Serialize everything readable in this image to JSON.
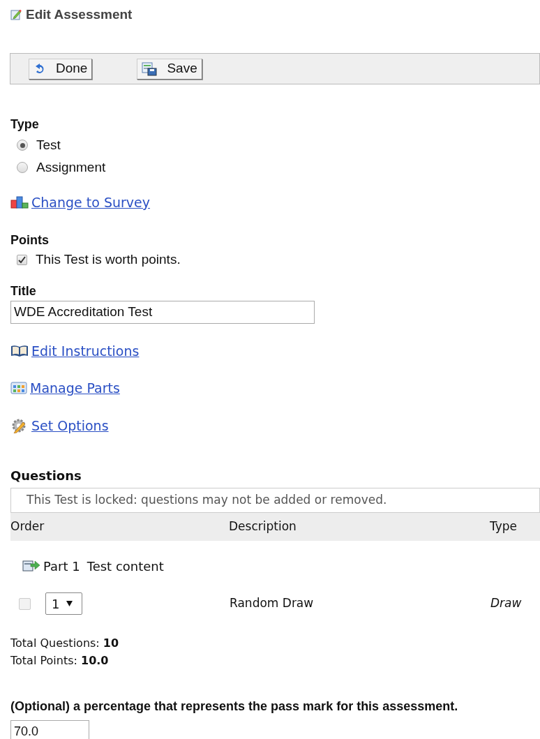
{
  "heading": "Edit Assessment",
  "toolbar": [
    {
      "kind": "done",
      "label": "Done"
    },
    {
      "kind": "save",
      "label": "Save"
    }
  ],
  "type": {
    "label": "Type",
    "options": [
      {
        "label": "Test",
        "selected": true
      },
      {
        "label": "Assignment",
        "selected": false
      }
    ]
  },
  "change_link": "Change to Survey",
  "points": {
    "label": "Points",
    "checkbox": {
      "label": "This Test is worth points.",
      "checked": true
    }
  },
  "title": {
    "label": "Title",
    "value": "WDE Accreditation Test"
  },
  "links": [
    {
      "kind": "instructions",
      "label": "Edit Instructions"
    },
    {
      "kind": "parts",
      "label": "Manage Parts"
    },
    {
      "kind": "options",
      "label": "Set Options"
    }
  ],
  "questions": {
    "label": "Questions",
    "notice": "This Test is locked: questions may not be added or removed.",
    "columns": [
      "Order",
      "Description",
      "Type"
    ],
    "part": {
      "label": "Part 1",
      "title": "Test content"
    },
    "rows": [
      {
        "checked": false,
        "order": "1",
        "description": "Random Draw",
        "type": "Draw"
      }
    ]
  },
  "totals": [
    "Total Questions: **10**",
    "Total Points: **10.0**"
  ],
  "pass_mark": {
    "label": "(Optional) a percentage that represents the pass mark for this assessment.",
    "value": "70.0"
  }
}
